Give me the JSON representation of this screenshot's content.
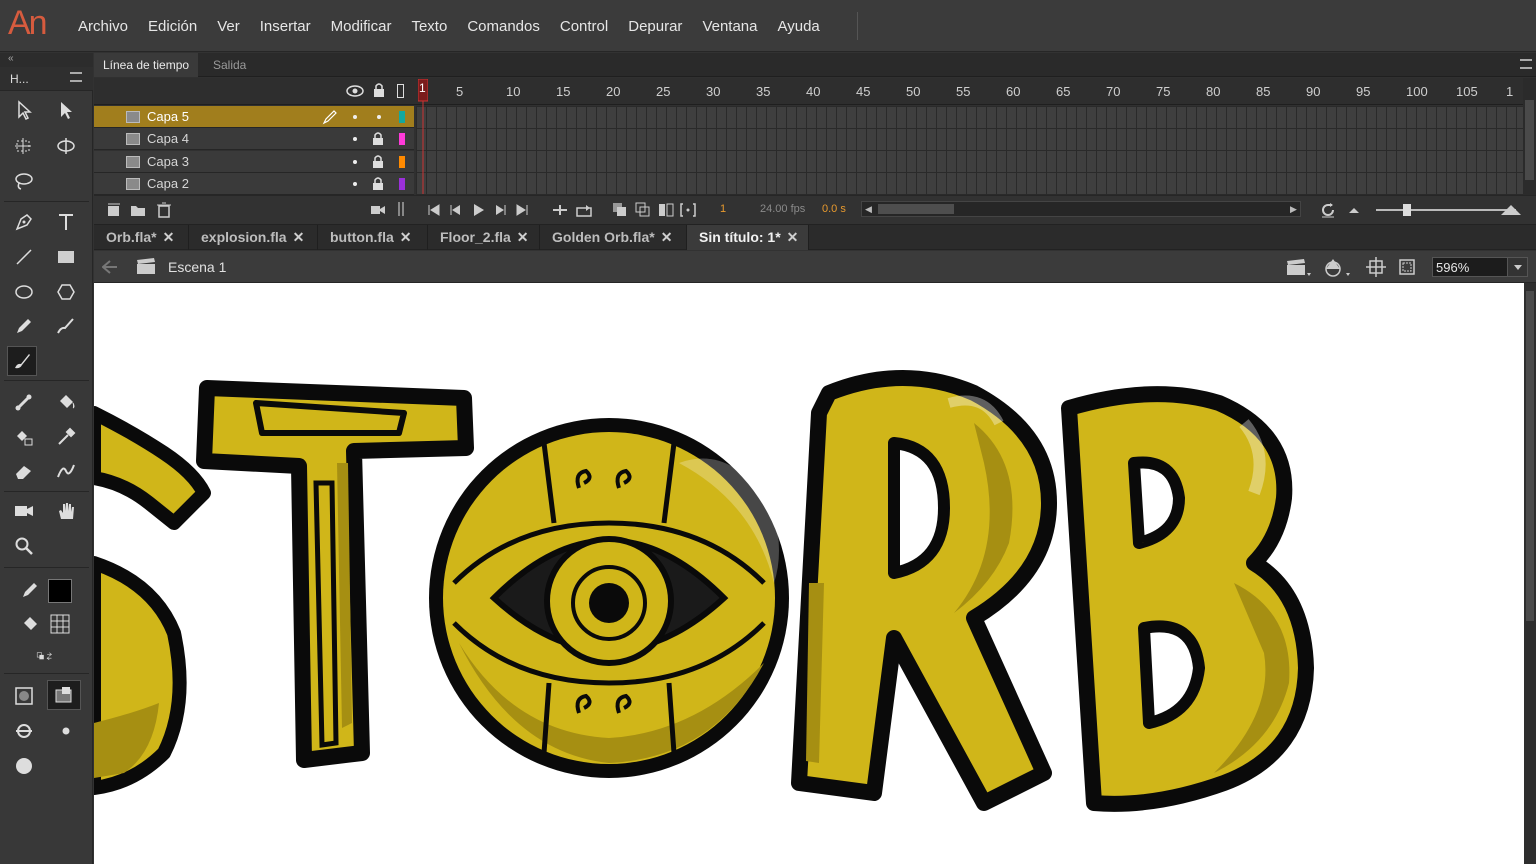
{
  "app": {
    "logo": "An"
  },
  "menu": [
    "Archivo",
    "Edición",
    "Ver",
    "Insertar",
    "Modificar",
    "Texto",
    "Comandos",
    "Control",
    "Depurar",
    "Ventana",
    "Ayuda"
  ],
  "toolbar": {
    "collapse_label": "«",
    "panel_title": "H...",
    "tools": [
      "selection-tool",
      "subselection-tool",
      "free-transform-tool",
      "3d-rotation-tool",
      "lasso-tool",
      "pen-tool",
      "text-tool",
      "line-tool",
      "rectangle-tool",
      "oval-tool",
      "polystar-tool",
      "pencil-tool",
      "paint-brush-tool",
      "brush-tool",
      "bone-tool",
      "paint-bucket-tool",
      "ink-bottle-tool",
      "eyedropper-tool",
      "eraser-tool",
      "width-tool",
      "camera-tool",
      "hand-tool",
      "zoom-tool"
    ],
    "active_tool": "brush-tool",
    "stroke_color": "#000000"
  },
  "timeline": {
    "tabs": [
      {
        "label": "Línea de tiempo",
        "active": true
      },
      {
        "label": "Salida",
        "active": false
      }
    ],
    "ruler": [
      "1",
      "5",
      "10",
      "15",
      "20",
      "25",
      "30",
      "35",
      "40",
      "45",
      "50",
      "55",
      "60",
      "65",
      "70",
      "75",
      "80",
      "85",
      "90",
      "95",
      "100",
      "105",
      "1"
    ],
    "layers": [
      {
        "name": "Capa 5",
        "active": true,
        "color": "#13a89e"
      },
      {
        "name": "Capa 4",
        "active": false,
        "color": "#ff3ad9"
      },
      {
        "name": "Capa 3",
        "active": false,
        "color": "#ff8a00"
      },
      {
        "name": "Capa 2",
        "active": false,
        "color": "#9b30d9"
      }
    ],
    "current_frame": "1",
    "fps": "24.00 fps",
    "time": "0.0 s"
  },
  "doc_tabs": [
    {
      "label": "Orb.fla*",
      "active": false
    },
    {
      "label": "explosion.fla",
      "active": false
    },
    {
      "label": "button.fla",
      "active": false
    },
    {
      "label": "Floor_2.fla",
      "active": false
    },
    {
      "label": "Golden Orb.fla*",
      "active": false
    },
    {
      "label": "Sin título: 1*",
      "active": true
    }
  ],
  "editbar": {
    "scene": "Escena 1",
    "zoom": "596%"
  },
  "artwork": {
    "fill": "#d0b619",
    "outline": "#0a0a0a",
    "shadow": "#a68f12"
  }
}
